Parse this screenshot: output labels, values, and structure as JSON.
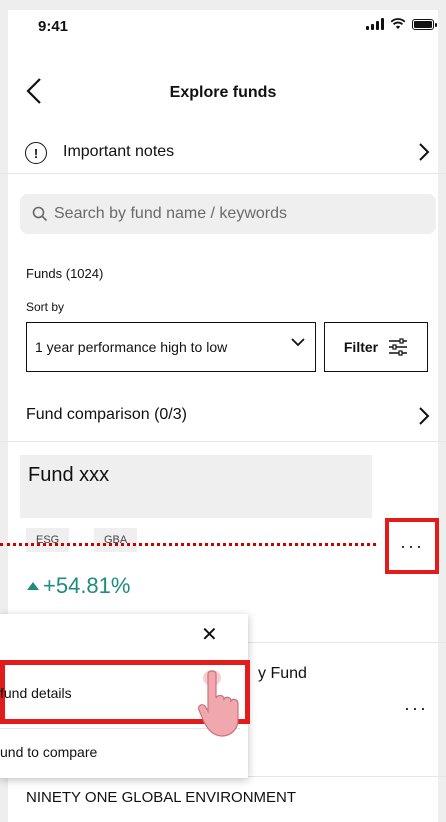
{
  "status": {
    "time": "9:41"
  },
  "header": {
    "title": "Explore funds"
  },
  "notes": {
    "label": "Important notes",
    "icon_text": "!"
  },
  "search": {
    "placeholder": "Search by fund name / keywords"
  },
  "funds": {
    "count_label": "Funds (1024)"
  },
  "sort": {
    "label": "Sort by",
    "selected": "1 year performance high to low"
  },
  "filter": {
    "label": "Filter"
  },
  "comparison": {
    "label": "Fund comparison (0/3)"
  },
  "fund_card": {
    "name": "Fund xxx",
    "tags": [
      "ESG",
      "GBA"
    ],
    "performance": "+54.81%",
    "more": "···"
  },
  "fund2": {
    "partial_name": "y Fund",
    "more": "···"
  },
  "popup": {
    "close": "✕",
    "item_details": "fund details",
    "item_compare": "und to compare"
  },
  "bottom_fund": {
    "name": "NINETY ONE GLOBAL ENVIRONMENT"
  },
  "colors": {
    "accent_red": "#e21b1b",
    "positive_green": "#1e8c7e"
  }
}
